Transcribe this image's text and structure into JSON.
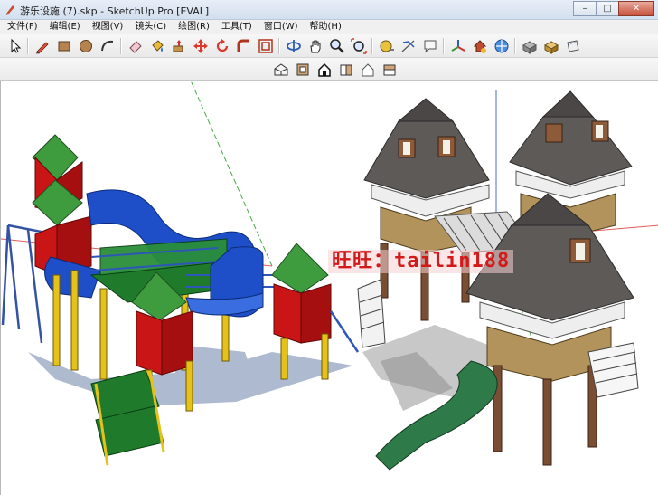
{
  "window": {
    "title": "游乐设施 (7).skp - SketchUp Pro [EVAL]",
    "controls": {
      "minimize": "–",
      "maximize": "□",
      "close": "✕"
    }
  },
  "menu": {
    "items": [
      "文件(F)",
      "编辑(E)",
      "视图(V)",
      "镜头(C)",
      "绘图(R)",
      "工具(T)",
      "窗口(W)",
      "帮助(H)"
    ]
  },
  "toolbar_main": {
    "tools": [
      "select-icon",
      "pencil-line-icon",
      "rectangle-icon",
      "circle-icon",
      "arc-icon",
      "eraser-icon",
      "paint-bucket-icon",
      "push-pull-icon",
      "move-icon",
      "rotate-icon",
      "follow-me-icon",
      "offset-icon",
      "orbit-icon",
      "pan-icon",
      "zoom-icon",
      "zoom-extents-icon",
      "tape-measure-icon",
      "dimension-icon",
      "text-icon",
      "axes-icon",
      "warehouse-icon",
      "components-icon",
      "extension-icon",
      "materials-icon"
    ]
  },
  "toolbar_views": {
    "tools": [
      "iso-view-icon",
      "top-view-icon",
      "front-view-icon",
      "right-view-icon",
      "back-view-icon",
      "left-view-icon"
    ]
  },
  "viewport": {
    "watermark": "旺旺：tailin188",
    "axis_colors": {
      "red": "#e05c5c",
      "green": "#49a949",
      "blue": "#4a6fd6"
    },
    "model_colors": {
      "roof_green": "#3e9b3e",
      "wall_red": "#c91515",
      "slide_blue": "#1e4fc8",
      "post_yellow": "#e5c21a",
      "deck_green": "#1f7a2b",
      "shingle_gray": "#5d5a58",
      "tower_brown": "#7a4e33",
      "slide_dark_green": "#2e7a49"
    }
  }
}
